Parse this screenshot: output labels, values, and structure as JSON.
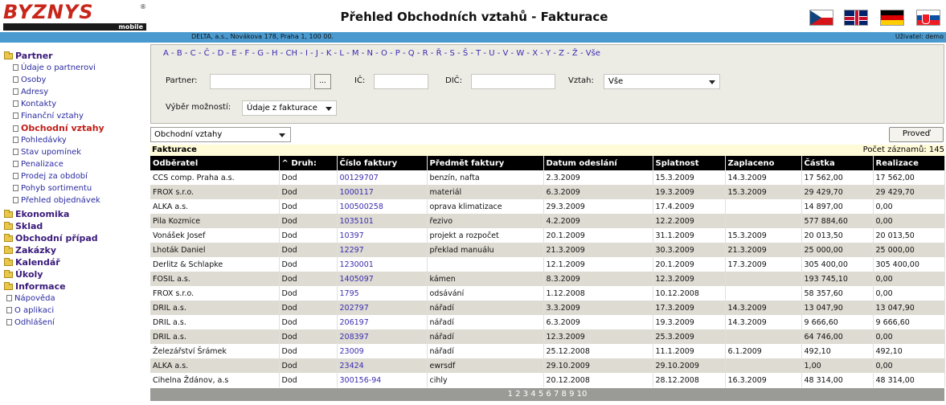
{
  "header": {
    "logo_text": "BYZNYS",
    "logo_reg": "®",
    "logo_sub": "mobile",
    "title": "Přehled Obchodních vztahů - Fakturace"
  },
  "languages": [
    "cz-flag-icon",
    "uk-flag-icon",
    "de-flag-icon",
    "sk-flag-icon"
  ],
  "infobar": {
    "company": "DELTA, a.s., Novákova 178, Praha 1, 100 00.",
    "user": "Uživatel: demo"
  },
  "sidebar": {
    "partner": "Partner",
    "partner_items": [
      "Údaje o partnerovi",
      "Osoby",
      "Adresy",
      "Kontakty",
      "Finanční vztahy",
      "Obchodní vztahy",
      "Pohledávky",
      "Stav upomínek",
      "Penalizace",
      "Prodej za období",
      "Pohyb sortimentu",
      "Přehled objednávek"
    ],
    "folders": [
      "Ekonomika",
      "Sklad",
      "Obchodní případ",
      "Zakázky",
      "Kalendář",
      "Úkoly",
      "Informace"
    ],
    "bottom_items": [
      "Nápověda",
      "O aplikaci",
      "Odhlášení"
    ]
  },
  "filter": {
    "alphabet": [
      "A",
      "B",
      "C",
      "Č",
      "D",
      "E",
      "F",
      "G",
      "H",
      "CH",
      "I",
      "J",
      "K",
      "L",
      "M",
      "N",
      "O",
      "P",
      "Q",
      "R",
      "Ř",
      "S",
      "Š",
      "T",
      "U",
      "V",
      "W",
      "X",
      "Y",
      "Z",
      "Ž",
      "Vše"
    ],
    "partner_label": "Partner:",
    "partner_value": "",
    "browse_label": "...",
    "ic_label": "IČ:",
    "ic_value": "",
    "dic_label": "DIČ:",
    "dic_value": "",
    "vztah_label": "Vztah:",
    "vztah_value": "Vše",
    "options_label": "Výběr možností:",
    "options_value": "Údaje z fakturace"
  },
  "toolbar": {
    "view_value": "Obchodní vztahy",
    "run_label": "Proveď"
  },
  "grid": {
    "title": "Fakturace",
    "count_label": "Počet záznamů: 145",
    "columns": [
      "Odběratel",
      "^ Druh:",
      "Číslo faktury",
      "Předmět faktury",
      "Datum odeslání",
      "Splatnost",
      "Zaplaceno",
      "Částka",
      "Realizace"
    ],
    "rows": [
      [
        "CCS comp. Praha a.s.",
        "Dod",
        "00129707",
        "benzín, nafta",
        "2.3.2009",
        "15.3.2009",
        "14.3.2009",
        "17 562,00",
        "17 562,00"
      ],
      [
        "FROX s.r.o.",
        "Dod",
        "1000117",
        "materiál",
        "6.3.2009",
        "19.3.2009",
        "15.3.2009",
        "29 429,70",
        "29 429,70"
      ],
      [
        "ALKA a.s.",
        "Dod",
        "100500258",
        "oprava klimatizace",
        "29.3.2009",
        "17.4.2009",
        "",
        "14 897,00",
        "0,00"
      ],
      [
        "Pila Kozmice",
        "Dod",
        "1035101",
        "řezivo",
        "4.2.2009",
        "12.2.2009",
        "",
        "577 884,60",
        "0,00"
      ],
      [
        "Vonášek Josef",
        "Dod",
        "10397",
        "projekt a rozpočet",
        "20.1.2009",
        "31.1.2009",
        "15.3.2009",
        "20 013,50",
        "20 013,50"
      ],
      [
        "Lhoták Daniel",
        "Dod",
        "12297",
        "překlad manuálu",
        "21.3.2009",
        "30.3.2009",
        "21.3.2009",
        "25 000,00",
        "25 000,00"
      ],
      [
        "Derlitz & Schlapke",
        "Dod",
        "1230001",
        "",
        "12.1.2009",
        "20.1.2009",
        "17.3.2009",
        "305 400,00",
        "305 400,00"
      ],
      [
        "FOSIL a.s.",
        "Dod",
        "1405097",
        "kámen",
        "8.3.2009",
        "12.3.2009",
        "",
        "193 745,10",
        "0,00"
      ],
      [
        "FROX s.r.o.",
        "Dod",
        "1795",
        "odsávání",
        "1.12.2008",
        "10.12.2008",
        "",
        "58 357,60",
        "0,00"
      ],
      [
        "DRIL a.s.",
        "Dod",
        "202797",
        "nářadí",
        "3.3.2009",
        "17.3.2009",
        "14.3.2009",
        "13 047,90",
        "13 047,90"
      ],
      [
        "DRIL a.s.",
        "Dod",
        "206197",
        "nářadí",
        "6.3.2009",
        "19.3.2009",
        "14.3.2009",
        "9 666,60",
        "9 666,60"
      ],
      [
        "DRIL a.s.",
        "Dod",
        "208397",
        "nářadí",
        "12.3.2009",
        "25.3.2009",
        "",
        "64 746,00",
        "0,00"
      ],
      [
        "Železářství Šrámek",
        "Dod",
        "23009",
        "nářadí",
        "25.12.2008",
        "11.1.2009",
        "6.1.2009",
        "492,10",
        "492,10"
      ],
      [
        "ALKA a.s.",
        "Dod",
        "23424",
        "ewrsdf",
        "29.10.2009",
        "29.10.2009",
        "",
        "1,00",
        "0,00"
      ],
      [
        "Cihelna Ždánov, a.s",
        "Dod",
        "300156-94",
        "cihly",
        "20.12.2008",
        "28.12.2008",
        "16.3.2009",
        "48 314,00",
        "48 314,00"
      ]
    ],
    "pages": [
      "1",
      "2",
      "3",
      "4",
      "5",
      "6",
      "7",
      "8",
      "9",
      "10"
    ]
  }
}
